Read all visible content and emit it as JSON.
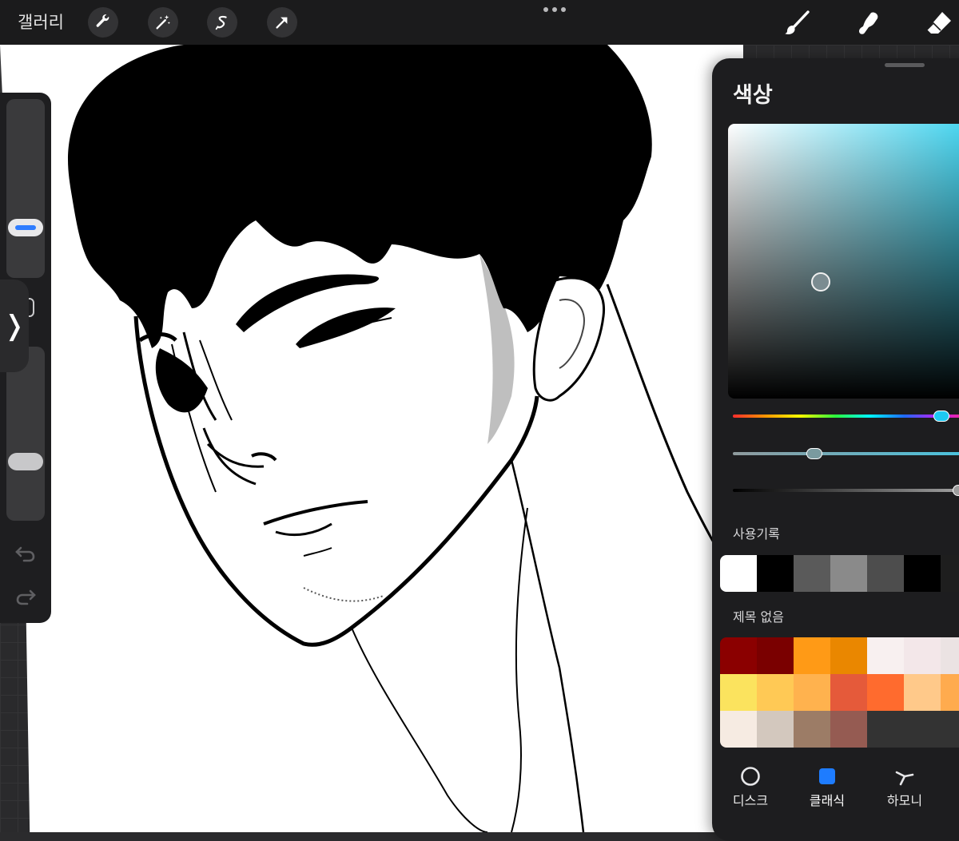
{
  "topbar": {
    "gallery_label": "갤러리",
    "tools": [
      "wrench-icon",
      "magic-wand-icon",
      "selection-s-icon",
      "transform-arrow-icon"
    ],
    "right_tools": [
      "brush-icon",
      "smudge-icon",
      "eraser-icon"
    ]
  },
  "sidebar": {
    "expand_glyph": "❭",
    "accent_color": "#2f7dff"
  },
  "color_panel": {
    "title": "색상",
    "current_color": "#7b8c91",
    "hue_level": 0.87,
    "saturation_level": 0.34,
    "brightness_level": 0.95,
    "history_label": "사용기록",
    "history_colors": [
      "#ffffff",
      "#000000",
      "#5a5a5a",
      "#8a8a8a",
      "#4d4d4d",
      "#000000",
      "#1e1e1e"
    ],
    "palette_label": "제목 없음",
    "palette_colors": [
      "#8b0000",
      "#7a0000",
      "#ff9a16",
      "#ea8700",
      "#f8f0f0",
      "#f3e7e9",
      "#ebe3e3",
      "#fbe35e",
      "#ffc955",
      "#ffb24e",
      "#e55a3a",
      "#ff6b2e",
      "#ffc98a",
      "#ffab4e",
      "#f6ebe2",
      "#d3c8be",
      "#9c7c66",
      "#955b52",
      "#333333",
      "#333333",
      "#333333"
    ],
    "tabs": [
      {
        "label": "디스크",
        "icon": "disc-circle-icon",
        "active": false
      },
      {
        "label": "클래식",
        "icon": "classic-square-icon",
        "active": true
      },
      {
        "label": "하모니",
        "icon": "harmony-icon",
        "active": false
      }
    ],
    "active_tab_color": "#1e7cff"
  }
}
